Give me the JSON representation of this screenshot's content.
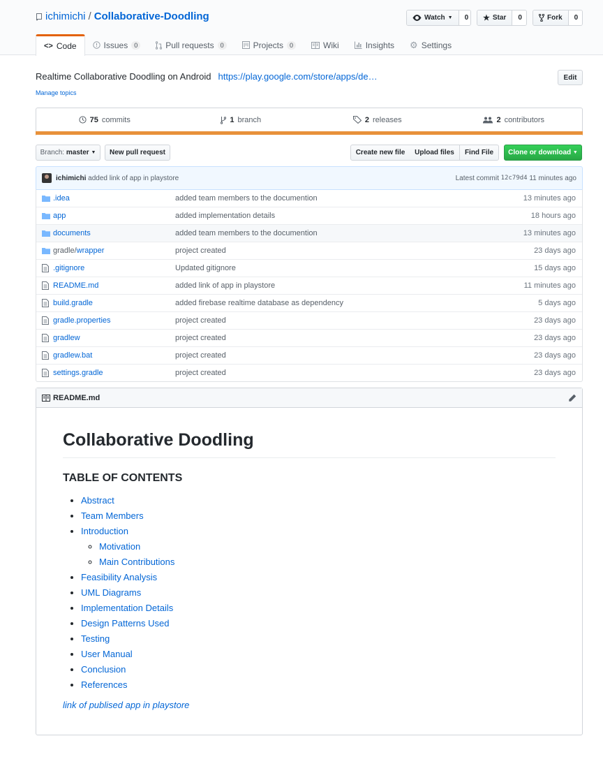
{
  "repo": {
    "owner": "ichimichi",
    "separator": "/",
    "name": "Collaborative-Doodling"
  },
  "actions": {
    "watch": {
      "label": "Watch",
      "count": "0"
    },
    "star": {
      "label": "Star",
      "count": "0"
    },
    "fork": {
      "label": "Fork",
      "count": "0"
    }
  },
  "tabs": [
    {
      "label": "Code",
      "icon": "code-icon"
    },
    {
      "label": "Issues",
      "count": "0",
      "icon": "issue-icon"
    },
    {
      "label": "Pull requests",
      "count": "0",
      "icon": "pr-icon"
    },
    {
      "label": "Projects",
      "count": "0",
      "icon": "project-icon"
    },
    {
      "label": "Wiki",
      "icon": "book-icon"
    },
    {
      "label": "Insights",
      "icon": "graph-icon"
    },
    {
      "label": "Settings",
      "icon": "gear-icon"
    }
  ],
  "description": {
    "text": "Realtime Collaborative Doodling on Android",
    "url": "https://play.google.com/store/apps/de…",
    "edit": "Edit",
    "manage_topics": "Manage topics"
  },
  "stats": {
    "commits": {
      "num": "75",
      "label": "commits"
    },
    "branches": {
      "num": "1",
      "label": "branch"
    },
    "releases": {
      "num": "2",
      "label": "releases"
    },
    "contributors": {
      "num": "2",
      "label": "contributors"
    }
  },
  "toolbar": {
    "branch_prefix": "Branch:",
    "branch": "master",
    "new_pr": "New pull request",
    "create_file": "Create new file",
    "upload": "Upload files",
    "find": "Find File",
    "clone": "Clone or download"
  },
  "commit": {
    "author": "ichimichi",
    "message": "added link of app in playstore",
    "latest_label": "Latest commit",
    "sha": "12c79d4",
    "age": "11 minutes ago"
  },
  "files": [
    {
      "name": ".idea",
      "type": "dir",
      "message": "added team members to the documention",
      "age": "13 minutes ago"
    },
    {
      "name": "app",
      "type": "dir",
      "message": "added implementation details",
      "age": "18 hours ago"
    },
    {
      "name": "documents",
      "type": "dir",
      "message": "added team members to the documention",
      "age": "13 minutes ago"
    },
    {
      "name": "gradle/",
      "name2": "wrapper",
      "type": "dir",
      "message": "project created",
      "age": "23 days ago"
    },
    {
      "name": ".gitignore",
      "type": "file",
      "message": "Updated gitignore",
      "age": "15 days ago"
    },
    {
      "name": "README.md",
      "type": "file",
      "message": "added link of app in playstore",
      "age": "11 minutes ago"
    },
    {
      "name": "build.gradle",
      "type": "file",
      "message": "added firebase realtime database as dependency",
      "age": "5 days ago"
    },
    {
      "name": "gradle.properties",
      "type": "file",
      "message": "project created",
      "age": "23 days ago"
    },
    {
      "name": "gradlew",
      "type": "file",
      "message": "project created",
      "age": "23 days ago"
    },
    {
      "name": "gradlew.bat",
      "type": "file",
      "message": "project created",
      "age": "23 days ago"
    },
    {
      "name": "settings.gradle",
      "type": "file",
      "message": "project created",
      "age": "23 days ago"
    }
  ],
  "readme": {
    "filename": "README.md",
    "h1": "Collaborative Doodling",
    "h2": "TABLE OF CONTENTS",
    "toc": [
      "Abstract",
      "Team Members",
      "Introduction",
      "Feasibility Analysis",
      "UML Diagrams",
      "Implementation Details",
      "Design Patterns Used",
      "Testing",
      "User Manual",
      "Conclusion",
      "References"
    ],
    "toc_sub": [
      "Motivation",
      "Main Contributions"
    ],
    "playstore_link": "link of publised app in playstore"
  },
  "colors": {
    "accent": "#0366d6",
    "tab_active": "#e36209",
    "lang_bar": "#e8913a",
    "clone_btn": "#2cbe4e"
  }
}
